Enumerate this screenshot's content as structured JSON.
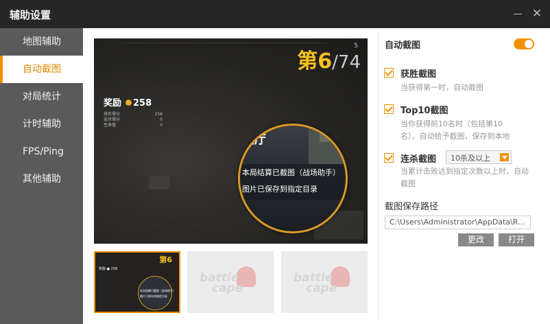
{
  "window": {
    "title": "辅助设置"
  },
  "sidebar": {
    "items": [
      {
        "label": "地图辅助"
      },
      {
        "label": "自动截图",
        "active": true
      },
      {
        "label": "对局统计"
      },
      {
        "label": "计时辅助"
      },
      {
        "label": "FPS/Ping"
      },
      {
        "label": "其他辅助"
      }
    ]
  },
  "preview": {
    "rank": "第6",
    "total": "/74",
    "rank_small": "5",
    "reward_label": "奖励",
    "reward_value": "258",
    "stats": [
      {
        "name": "排名得分",
        "value": "258"
      },
      {
        "name": "击杀得分",
        "value": "0"
      },
      {
        "name": "生命值",
        "value": "0"
      }
    ],
    "magnifier": {
      "hall": "大厅",
      "line1": "本局结算已截图（战场助手）",
      "line2": "图片已保存到指定目录"
    }
  },
  "thumbnails": {
    "thumb1": {
      "rank": "第6",
      "reward": "奖励 ● 258",
      "line1": "本局结算已截图（战场助手）",
      "line2": "图片已保存到指定目录"
    },
    "watermark": {
      "line1": "battle",
      "line2": "cape"
    }
  },
  "settings": {
    "auto_screenshot": {
      "label": "自动截图",
      "enabled": true
    },
    "win": {
      "label": "获胜截图",
      "checked": true,
      "desc": "当获得第一时，自动截图"
    },
    "top10": {
      "label": "Top10截图",
      "checked": true,
      "desc": "当你获得前10名时（包括第10名），自动给予截图，保存到本地"
    },
    "killstreak": {
      "label": "连杀截图",
      "checked": true,
      "select_value": "10杀及以上",
      "desc": "当累计击败达到指定次数以上时，自动截图"
    },
    "path": {
      "label": "截图保存路径",
      "value": "C:\\Users\\Administrator\\AppData\\R...",
      "change_label": "更改",
      "open_label": "打开"
    }
  },
  "colors": {
    "accent": "#f29100",
    "sidebar_bg": "#5a5a5a",
    "titlebar_bg": "#262626"
  }
}
